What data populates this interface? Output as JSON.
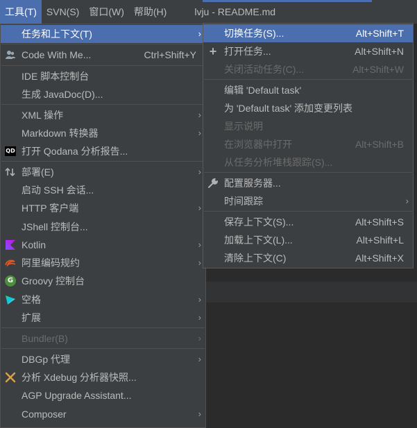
{
  "menubar": {
    "items": [
      "工具(T)",
      "SVN(S)",
      "窗口(W)",
      "帮助(H)"
    ],
    "window_title": "lvju - README.md"
  },
  "main_menu": {
    "items": [
      {
        "label": "任务和上下文(T)",
        "arrow": "›"
      },
      {
        "label": "Code With Me...",
        "shortcut": "Ctrl+Shift+Y",
        "icon": "people-icon"
      },
      {
        "label": "IDE 脚本控制台"
      },
      {
        "label": "生成 JavaDoc(D)..."
      },
      {
        "label": "XML 操作",
        "arrow": "›"
      },
      {
        "label": "Markdown 转换器",
        "arrow": "›"
      },
      {
        "label": "打开 Qodana 分析报告...",
        "icon": "qodana-icon",
        "icon_text": "QD"
      },
      {
        "label": "部署(E)",
        "arrow": "›",
        "icon": "deploy-icon"
      },
      {
        "label": "启动 SSH 会话..."
      },
      {
        "label": "HTTP 客户端",
        "arrow": "›"
      },
      {
        "label": "JShell 控制台..."
      },
      {
        "label": "Kotlin",
        "arrow": "›",
        "icon": "kotlin-icon"
      },
      {
        "label": "阿里编码规约",
        "arrow": "›",
        "icon": "alibaba-icon"
      },
      {
        "label": "Groovy 控制台",
        "icon": "groovy-icon",
        "icon_text": "G"
      },
      {
        "label": "空格",
        "arrow": "›",
        "icon": "space-icon"
      },
      {
        "label": "扩展",
        "arrow": "›"
      },
      {
        "label": "Bundler(B)",
        "arrow": "›"
      },
      {
        "label": "DBGp 代理",
        "arrow": "›"
      },
      {
        "label": "分析 Xdebug 分析器快照...",
        "icon": "xdebug-icon"
      },
      {
        "label": "AGP Upgrade Assistant..."
      },
      {
        "label": "Composer",
        "arrow": "›"
      }
    ]
  },
  "sub_menu": {
    "items": [
      {
        "label": "切换任务(S)...",
        "shortcut": "Alt+Shift+T"
      },
      {
        "label": "打开任务...",
        "shortcut": "Alt+Shift+N",
        "icon": "plus-icon",
        "icon_text": "+"
      },
      {
        "label": "关闭活动任务(C)...",
        "shortcut": "Alt+Shift+W"
      },
      {
        "label": "编辑 'Default task'"
      },
      {
        "label": "为 'Default task' 添加变更列表"
      },
      {
        "label": "显示说明"
      },
      {
        "label": "在浏览器中打开",
        "shortcut": "Alt+Shift+B"
      },
      {
        "label": "从任务分析堆栈跟踪(S)..."
      },
      {
        "label": "配置服务器...",
        "icon": "wrench-icon"
      },
      {
        "label": "时间跟踪",
        "arrow": "›"
      },
      {
        "label": "保存上下文(S)...",
        "shortcut": "Alt+Shift+S"
      },
      {
        "label": "加载上下文(L)...",
        "shortcut": "Alt+Shift+L"
      },
      {
        "label": "清除上下文(C)",
        "shortcut": "Alt+Shift+X"
      }
    ]
  }
}
